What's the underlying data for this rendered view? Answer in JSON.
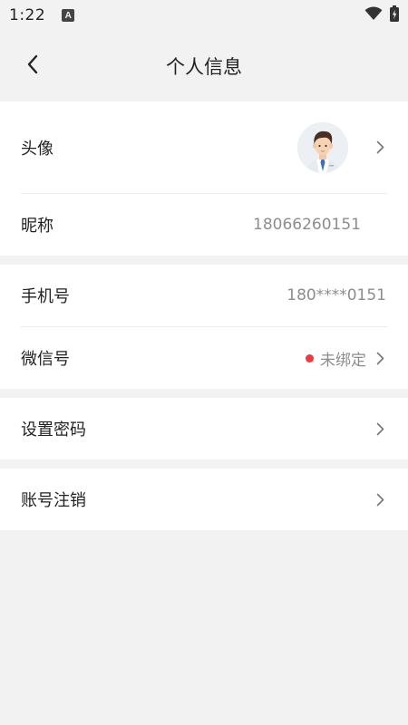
{
  "status_bar": {
    "time": "1:22",
    "notif_icon_letter": "A"
  },
  "header": {
    "title": "个人信息"
  },
  "rows": {
    "avatar": {
      "label": "头像"
    },
    "nickname": {
      "label": "昵称",
      "value": "18066260151"
    },
    "phone": {
      "label": "手机号",
      "value": "180****0151"
    },
    "wechat": {
      "label": "微信号",
      "value": "未绑定"
    },
    "password": {
      "label": "设置密码"
    },
    "cancel_account": {
      "label": "账号注销"
    }
  },
  "colors": {
    "background": "#f2f2f2",
    "accent_red": "#f0383f",
    "muted_text": "#8d8d8d"
  }
}
